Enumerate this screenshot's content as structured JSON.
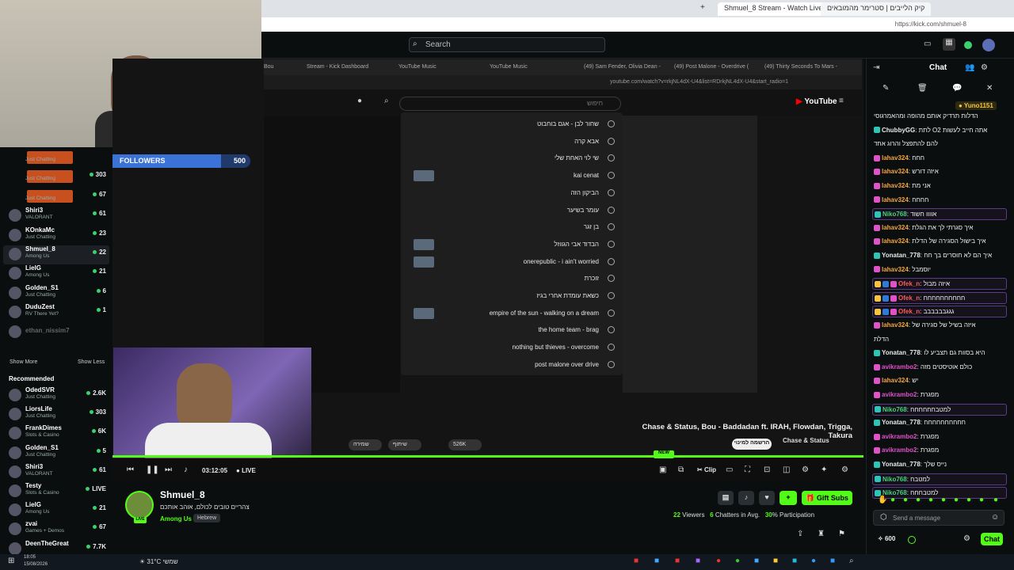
{
  "browser": {
    "tabs": [
      {
        "label": "Shmuel_8 Stream - Watch Live on"
      },
      {
        "label": "קיק הלייבים | סטרימר מהמובאים"
      }
    ],
    "url": "https://kick.com/shmuel-8"
  },
  "header": {
    "search_placeholder": "Search"
  },
  "inner_tabs": [
    "Bou",
    "Stream - Kick Dashboard",
    "YouTube Music",
    "YouTube Music",
    "(49) Sam Fender, Olivia Dean -",
    "(49) Post Malone - Overdrive (",
    "(49) Thirty Seconds To Mars -"
  ],
  "inner_url": "youtube.com/watch?v=rkjNL4dX-U4&list=RDrkjNL4dX-U4&start_radio=1",
  "youtube": {
    "logo": "YouTube",
    "search_value": "",
    "search_placeholder": "חיפוש",
    "suggestions": [
      "שחור לבן - אגם בוחבוט",
      "אבא קרה",
      "שי לוי האחת שלי",
      "kai cenat",
      "הביקון הזה",
      "עומר בשיער",
      "בן זגר",
      "הבדוד אבי הגווזל",
      "onerepublic - i ain't worried",
      "זוכרת",
      "כשאת עומדת אחרי בגיז",
      "empire of the sun - walking on a dream",
      "the home team - brag",
      "nothing but thieves - overcome",
      "post malone over drive"
    ],
    "song_title": "Chase & Status, Bou - Baddadan ft. IRAH, Flowdan, Trigga, Takura",
    "channel": "Chase & Status",
    "like_count": "526K",
    "subscribe": "הרשמה למינוי",
    "share": "שיתוף",
    "save": "שמירה"
  },
  "overlay": {
    "followers_label": "FOLLOWERS",
    "current": "438",
    "goal": "500",
    "progress": 0.876
  },
  "sidebar": {
    "following": [
      {
        "name": "",
        "category": "Just Chatting",
        "viewers": ""
      },
      {
        "name": "",
        "category": "Just Chatting",
        "viewers": "303"
      },
      {
        "name": "",
        "category": "Just Chatting",
        "viewers": "67"
      },
      {
        "name": "Shiri3",
        "category": "VALORANT",
        "viewers": "61"
      },
      {
        "name": "KOnkaMc",
        "category": "Just Chatting",
        "viewers": "23"
      },
      {
        "name": "Shmuel_8",
        "category": "Among Us",
        "viewers": "22"
      },
      {
        "name": "LielG",
        "category": "Among Us",
        "viewers": "21"
      },
      {
        "name": "Golden_S1",
        "category": "Just Chatting",
        "viewers": "6"
      },
      {
        "name": "DuduZest",
        "category": "RV There Yet?",
        "viewers": "1"
      },
      {
        "name": "ethan_nissim7",
        "category": "",
        "viewers": ""
      }
    ],
    "show_more": "Show More",
    "show_less": "Show Less",
    "recommended_title": "Recommended",
    "recommended": [
      {
        "name": "OdedSVR",
        "category": "Just Chatting",
        "viewers": "2.6K"
      },
      {
        "name": "LiorsLife",
        "category": "Just Chatting",
        "viewers": "303"
      },
      {
        "name": "FrankDimes",
        "category": "Slots & Casino",
        "viewers": "6K"
      },
      {
        "name": "Golden_S1",
        "category": "Just Chatting",
        "viewers": "5"
      },
      {
        "name": "Shiri3",
        "category": "VALORANT",
        "viewers": "61"
      },
      {
        "name": "Testy",
        "category": "Slots & Casino",
        "viewers": "LIVE"
      },
      {
        "name": "LielG",
        "category": "Among Us",
        "viewers": "21"
      },
      {
        "name": "zvai",
        "category": "Games + Demos",
        "viewers": "67"
      },
      {
        "name": "DeenTheGreat",
        "category": "",
        "viewers": "7.7K"
      }
    ]
  },
  "player": {
    "time": "03:12:05",
    "live": "LIVE",
    "clip": "Clip",
    "new_badge": "NEW"
  },
  "stream_info": {
    "streamer": "Shmuel_8",
    "title": "צהריים טובים לכולם, אוהב אותכם",
    "category": "Among Us",
    "tag": "Hebrew",
    "viewers": "22",
    "viewers_label": "Viewers",
    "chatters": "6",
    "chatters_label": "Chatters in Avg.",
    "participation": "30",
    "participation_label": "% Participation",
    "gift_subs": "Gift Subs"
  },
  "chat": {
    "title": "Chat",
    "top_user": "Yuno1151",
    "messages": [
      {
        "user": "",
        "text": "הדלות תרדיק אותם מהופה ומהאמרגוסי",
        "color": "#eee",
        "badges": 0
      },
      {
        "user": "ChubbyGG",
        "text": "לתת O2 אתה חייב לעשות",
        "color": "#e8e8e8",
        "badges": 1
      },
      {
        "user": "",
        "text": "להם להתפצל והרוג אחד",
        "color": "#eee",
        "badges": 0
      },
      {
        "user": "lahav324",
        "text": "חחח",
        "color": "#f2a541",
        "badges": 1
      },
      {
        "user": "lahav324",
        "text": "איזה דורש",
        "color": "#f2a541",
        "badges": 1
      },
      {
        "user": "lahav324",
        "text": "אני מת",
        "color": "#f2a541",
        "badges": 1
      },
      {
        "user": "lahav324",
        "text": "חחחח",
        "color": "#f2a541",
        "badges": 1
      },
      {
        "user": "Niko768",
        "text": "אוווו חשוד",
        "color": "#49d17a",
        "badges": 1,
        "hl": true
      },
      {
        "user": "lahav324",
        "text": "איך סגרתי לך את הגלת",
        "color": "#f2a541",
        "badges": 1
      },
      {
        "user": "lahav324",
        "text": "איך בישול הסגירה של הדלת",
        "color": "#f2a541",
        "badges": 1
      },
      {
        "user": "Yonatan_778",
        "text": "איך הם לא חוסרים בך חח",
        "color": "#e8e8e8",
        "badges": 1
      },
      {
        "user": "lahav324",
        "text": "יוסמבל",
        "color": "#f2a541",
        "badges": 1
      },
      {
        "user": "Ofek_n",
        "text": "איזה מבול",
        "color": "#ff5a5a",
        "badges": 3,
        "hl": true
      },
      {
        "user": "Ofek_n",
        "text": "חחחחחחחחחח",
        "color": "#ff5a5a",
        "badges": 3,
        "hl": true
      },
      {
        "user": "Ofek_n",
        "text": "גגגבבבבבב",
        "color": "#ff5a5a",
        "badges": 3,
        "hl": true
      },
      {
        "user": "lahav324",
        "text": "איזה בשיל של סגירה של",
        "color": "#f2a541",
        "badges": 1
      },
      {
        "user": "",
        "text": "הדלת",
        "color": "#eee",
        "badges": 0
      },
      {
        "user": "Yonatan_778",
        "text": "היא בסוות גם תצביע לו",
        "color": "#e8e8e8",
        "badges": 1
      },
      {
        "user": "avikrambo2",
        "text": "כולם אוטיסטים מזה",
        "color": "#e052c8",
        "badges": 1
      },
      {
        "user": "lahav324",
        "text": "יש",
        "color": "#f2a541",
        "badges": 1
      },
      {
        "user": "avikrambo2",
        "text": "מפגרת",
        "color": "#e052c8",
        "badges": 1
      },
      {
        "user": "Niko768",
        "text": "למטבחחחחחח",
        "color": "#49d17a",
        "badges": 1,
        "hl": true
      },
      {
        "user": "Yonatan_778",
        "text": "חחחחחחחחחח",
        "color": "#e8e8e8",
        "badges": 1
      },
      {
        "user": "avikrambo2",
        "text": "מפגרת",
        "color": "#e052c8",
        "badges": 1
      },
      {
        "user": "avikrambo2",
        "text": "מפגרת",
        "color": "#e052c8",
        "badges": 1
      },
      {
        "user": "Yonatan_778",
        "text": "נייס שלך",
        "color": "#e8e8e8",
        "badges": 1
      },
      {
        "user": "Niko768",
        "text": "למטבח",
        "color": "#49d17a",
        "badges": 1,
        "hl": true
      },
      {
        "user": "Niko768",
        "text": "למטבחחח",
        "color": "#49d17a",
        "badges": 1,
        "hl": true
      }
    ],
    "send_placeholder": "Send a message",
    "points": "600",
    "chat_button": "Chat"
  },
  "taskbar": {
    "time": "18:05",
    "date": "15/08/2026",
    "weather": "31°C",
    "weather_label": "שמשי"
  }
}
